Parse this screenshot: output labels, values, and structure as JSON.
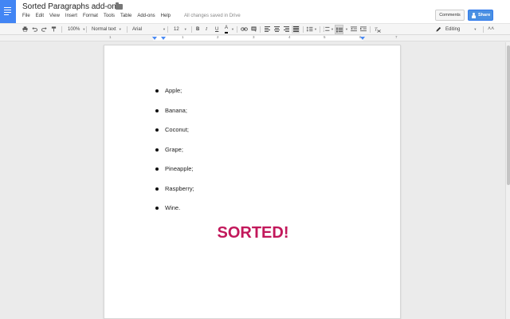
{
  "header": {
    "title": "Sorted Paragraphs add-on",
    "menu": [
      "File",
      "Edit",
      "View",
      "Insert",
      "Format",
      "Tools",
      "Table",
      "Add-ons",
      "Help"
    ],
    "save_status": "All changes saved in Drive",
    "comments_label": "Comments",
    "share_label": "Share"
  },
  "toolbar": {
    "zoom": "100%",
    "style": "Normal text",
    "font": "Arial",
    "font_size": "12",
    "bold": "B",
    "italic": "I",
    "underline": "U",
    "text_color": "A",
    "mode": "Editing"
  },
  "ruler": {
    "numbers": [
      "1",
      "1",
      "2",
      "3",
      "4",
      "5",
      "6",
      "7"
    ]
  },
  "document": {
    "items": [
      "Apple;",
      "Banana;",
      "Coconut;",
      "Grape;",
      "Pineapple;",
      "Raspberry;",
      "Wine."
    ],
    "banner": "SORTED!",
    "banner_color": "#c2185b"
  },
  "colors": {
    "accent": "#4285f4",
    "share_button": "#4a90e2"
  }
}
